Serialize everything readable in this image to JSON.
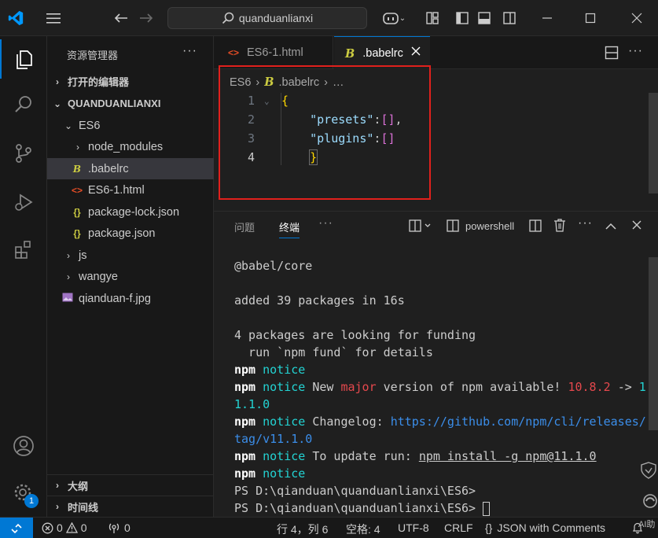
{
  "titlebar": {
    "search_text": "quanduanlianxi"
  },
  "sidebar": {
    "title": "资源管理器",
    "items": [
      {
        "label": "打开的编辑器"
      },
      {
        "label": "QUANDUANLIANXI"
      },
      {
        "label": "ES6"
      },
      {
        "label": "node_modules"
      },
      {
        "label": ".babelrc"
      },
      {
        "label": "ES6-1.html"
      },
      {
        "label": "package-lock.json"
      },
      {
        "label": "package.json"
      },
      {
        "label": "js"
      },
      {
        "label": "wangye"
      },
      {
        "label": "qianduan-f.jpg"
      }
    ],
    "outline": "大纲",
    "timeline": "时间线"
  },
  "tabs": [
    {
      "label": "ES6-1.html"
    },
    {
      "label": ".babelrc"
    }
  ],
  "breadcrumb": {
    "folder": "ES6",
    "file": ".babelrc",
    "more": "…"
  },
  "editor": {
    "lines": [
      {
        "num": "1",
        "text": "{"
      },
      {
        "num": "2",
        "text": "    \"presets\":[],"
      },
      {
        "num": "3",
        "text": "    \"plugins\":[]"
      },
      {
        "num": "4",
        "text": "    }"
      }
    ]
  },
  "panel": {
    "tabs": [
      {
        "label": "问题"
      },
      {
        "label": "终端"
      }
    ],
    "shell": "powershell",
    "terminal": {
      "l1": "@babel/core",
      "l2": "added 39 packages in 16s",
      "l3": "4 packages are looking for funding",
      "l4": "  run `npm fund` for details",
      "npm": "npm",
      "notice": "notice",
      "new": "New",
      "major": "major",
      "version_of": "version of npm available!",
      "v_old": "10.8.2",
      "arrow": "->",
      "v_new1": "1",
      "v_new2": "1.1.0",
      "changelog": "Changelog:",
      "url1": "https://github.com/npm/cli/releases/",
      "url2": "tag/v11.1.0",
      "update": "To update run:",
      "cmd": "npm install -g npm@11.1.0",
      "ps1": "PS D:\\qianduan\\quanduanlianxi\\ES6>",
      "ps2": "PS D:\\qianduan\\quanduanlianxi\\ES6>"
    }
  },
  "status": {
    "errors": "0",
    "warnings": "0",
    "ports": "0",
    "position": "行 4，列 6",
    "spaces": "空格: 4",
    "encoding": "UTF-8",
    "eol": "CRLF",
    "language": "JSON with Comments",
    "notif_badge": "1",
    "ai": "AI助"
  },
  "colors": {
    "accent": "#0078d4",
    "highlight_box": "#e0201c"
  }
}
